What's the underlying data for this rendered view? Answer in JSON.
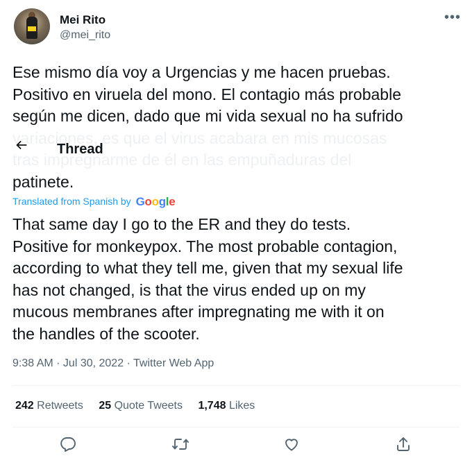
{
  "author": {
    "name": "Mei Rito",
    "handle": "@mei_rito"
  },
  "header": {
    "title": "Thread"
  },
  "tweet": {
    "original_lines_visible": [
      "Ese mismo día voy a Urgencias y me hacen pruebas.",
      "Positivo en viruela del mono. El contagio más probable",
      "según me dicen, dado que mi vida sexual no ha sufrido"
    ],
    "original_lines_faded": [
      "variaciones, es que el virus acabara en mis mucosas",
      "tras impregnarme de él en las empuñaduras del"
    ],
    "original_last_line": "patinete.",
    "translation_label": "Translated from Spanish by",
    "translation_provider": "Google",
    "translated_lines": [
      "That same day I go to the ER and they do tests.",
      "Positive for monkeypox. The most probable contagion,",
      "according to what they tell me, given that my sexual life",
      "has not changed, is that the virus ended up on my",
      "mucous membranes after impregnating me with it on",
      "the handles of the scooter."
    ],
    "timestamp": "9:38 AM · Jul 30, 2022 · Twitter Web App"
  },
  "stats": {
    "retweets_count": "242",
    "retweets_label": "Retweets",
    "quotes_count": "25",
    "quotes_label": "Quote Tweets",
    "likes_count": "1,748",
    "likes_label": "Likes"
  },
  "icons": {
    "back": "arrow-left-icon",
    "more": "more-icon",
    "reply": "reply-icon",
    "retweet": "retweet-icon",
    "like": "heart-icon",
    "share": "share-icon"
  },
  "colors": {
    "text": "#0f1419",
    "muted": "#536471",
    "link": "#1d9bf0",
    "divider": "#eff3f4"
  }
}
